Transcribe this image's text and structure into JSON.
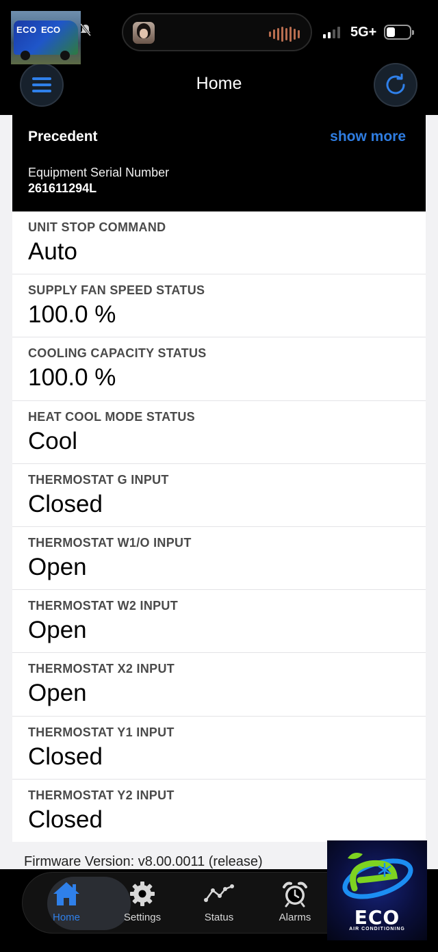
{
  "status_bar": {
    "network": "5G+",
    "signal_bars_filled": 2,
    "signal_bars_total": 4,
    "wallpaper_van_text": "ECO",
    "wallpaper_van_text2": "ECO"
  },
  "nav": {
    "title": "Home",
    "menu_icon": "hamburger-icon",
    "refresh_icon": "refresh-icon"
  },
  "device": {
    "name": "Precedent",
    "show_more": "show more",
    "serial_label": "Equipment Serial Number",
    "serial_value": "261611294L"
  },
  "points": [
    {
      "label": "UNIT STOP COMMAND",
      "value": "Auto"
    },
    {
      "label": "SUPPLY FAN SPEED STATUS",
      "value": "100.0 %"
    },
    {
      "label": "COOLING CAPACITY STATUS",
      "value": "100.0 %"
    },
    {
      "label": "HEAT COOL MODE STATUS",
      "value": "Cool"
    },
    {
      "label": "THERMOSTAT G INPUT",
      "value": "Closed"
    },
    {
      "label": "THERMOSTAT W1/O INPUT",
      "value": "Open"
    },
    {
      "label": "THERMOSTAT W2 INPUT",
      "value": "Open"
    },
    {
      "label": "THERMOSTAT X2 INPUT",
      "value": "Open"
    },
    {
      "label": "THERMOSTAT Y1 INPUT",
      "value": "Closed"
    },
    {
      "label": "THERMOSTAT Y2 INPUT",
      "value": "Closed"
    }
  ],
  "firmware": "Firmware Version: v8.00.0011 (release)",
  "tabs": [
    {
      "label": "Home",
      "icon": "home-icon",
      "active": true
    },
    {
      "label": "Settings",
      "icon": "gear-icon",
      "active": false
    },
    {
      "label": "Status",
      "icon": "trend-icon",
      "active": false
    },
    {
      "label": "Alarms",
      "icon": "alarm-clock-icon",
      "active": false
    }
  ],
  "logo": {
    "word": "ECO",
    "subtitle": "AIR CONDITIONING"
  },
  "colors": {
    "accent": "#2f80ea",
    "header_bg": "#000000",
    "page_bg": "#f2f2f4"
  }
}
